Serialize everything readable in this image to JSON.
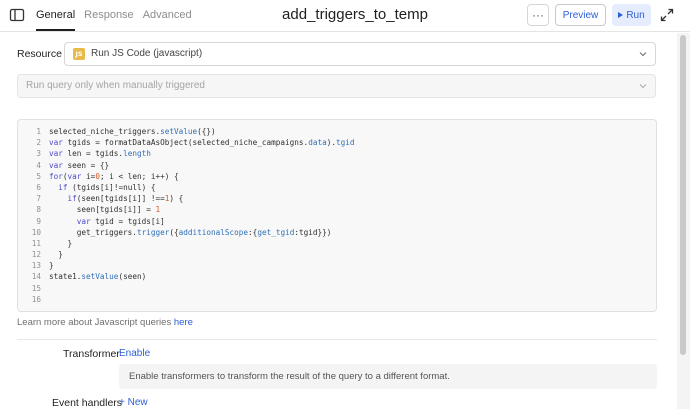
{
  "header": {
    "tabs": [
      {
        "label": "General",
        "active": true
      },
      {
        "label": "Response",
        "active": false
      },
      {
        "label": "Advanced",
        "active": false
      }
    ],
    "query_name": "add_triggers_to_temp",
    "more_label": "···",
    "preview_label": "Preview",
    "run_label": "Run"
  },
  "resource": {
    "label": "Resource",
    "badge": "JS",
    "value": "Run JS Code (javascript)",
    "trigger_mode": "Run query only when manually triggered"
  },
  "editor": {
    "line_numbers": [
      "1",
      "2",
      "3",
      "4",
      "5",
      "6",
      "7",
      "8",
      "9",
      "10",
      "11",
      "12",
      "13",
      "14",
      "15",
      "16"
    ],
    "lines": [
      "selected_niche_triggers.setValue({})",
      "var tgids = formatDataAsObject(selected_niche_campaigns.data).tgid",
      "var len = tgids.length",
      "var seen = {}",
      "for(var i=0; i < len; i++) {",
      "  if (tgids[i]!=null) {",
      "    if(seen[tgids[i]] !==1) {",
      "      seen[tgids[i]] = 1",
      "      var tgid = tgids[i]",
      "      get_triggers.trigger({additionalScope:{get_tgid:tgid}})",
      "    }",
      "  }",
      "}",
      "state1.setValue(seen)",
      "",
      ""
    ]
  },
  "learn_more": {
    "text": "Learn more about Javascript queries ",
    "link": "here"
  },
  "transformer": {
    "label": "Transformer",
    "enable_label": "Enable",
    "description": "Enable transformers to transform the result of the query to a different format."
  },
  "event_handlers": {
    "label": "Event handlers",
    "new_label": "+ New"
  },
  "colors": {
    "accent": "#2c5fd6",
    "run_bg": "#e4ecfd",
    "js_badge": "#e9b949"
  }
}
